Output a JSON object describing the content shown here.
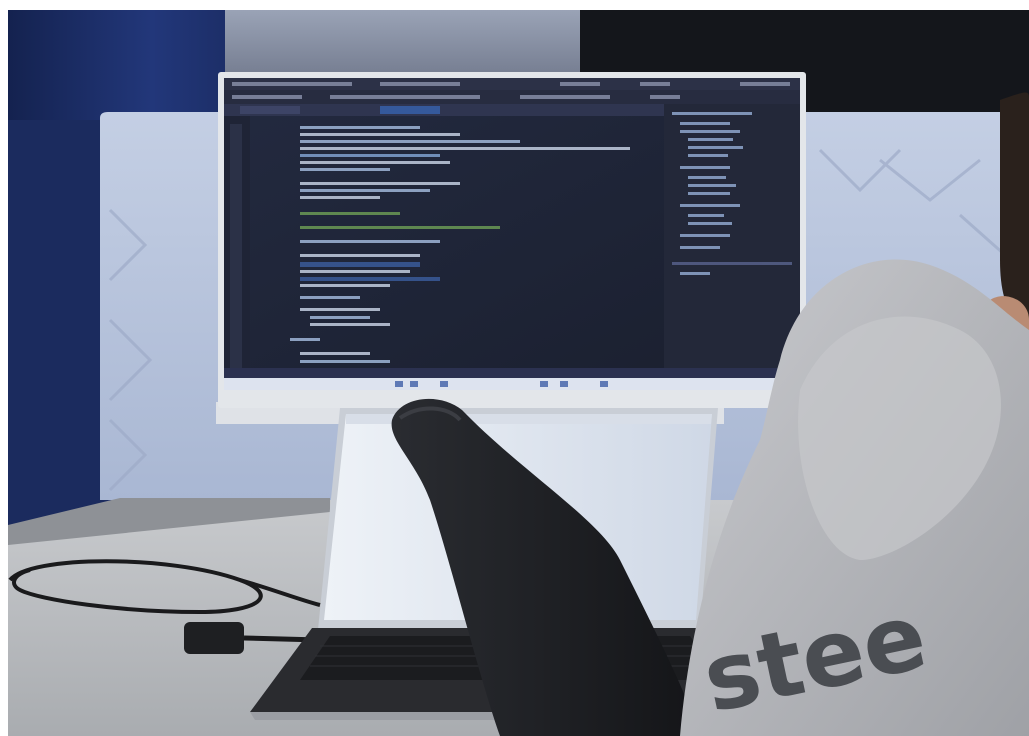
{
  "photo": {
    "hoodie_print": "stee"
  },
  "colors": {
    "curtain_blue": "#1c2e63",
    "panel_light_blue": "#b7c4de",
    "desk_grey": "#b9bcc0",
    "monitor_bezel": "#e3e6ea",
    "ide_background": "#1e2233",
    "ide_sidebar": "#252a3b",
    "laptop_screen": "#dfe5ee",
    "chair_black": "#1a1b1e",
    "hoodie_grey": "#b8b9bd"
  }
}
